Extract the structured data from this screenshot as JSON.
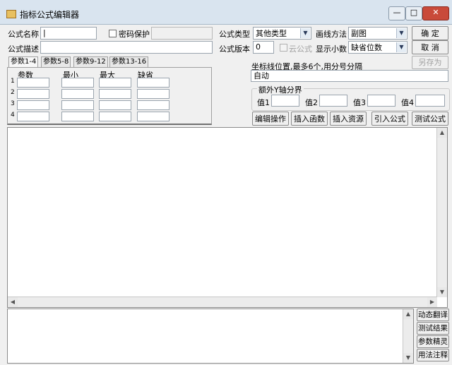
{
  "window": {
    "title": "指标公式编辑器",
    "min_label": "—",
    "max_label": "□",
    "close_label": "✕"
  },
  "form": {
    "name_label": "公式名称",
    "name_value": "|",
    "password_label": "密码保护",
    "desc_label": "公式描述",
    "desc_value": "",
    "type_label": "公式类型",
    "type_value": "其他类型",
    "version_label": "公式版本",
    "version_value": "0",
    "cloud_label": "云公式",
    "draw_label": "画线方法",
    "draw_value": "副图",
    "decimal_label": "显示小数",
    "decimal_value": "缺省位数",
    "ok_label": "确 定",
    "cancel_label": "取 消",
    "saveas_label": "另存为"
  },
  "params": {
    "tabs": [
      "参数1-4",
      "参数5-8",
      "参数9-12",
      "参数13-16"
    ],
    "headers": [
      "参数",
      "最小",
      "最大",
      "缺省"
    ],
    "rows": [
      "1",
      "2",
      "3",
      "4"
    ]
  },
  "axis": {
    "label": "坐标线位置,最多6个,用分号分隔",
    "value": "自动",
    "group_label": "额外Y轴分界",
    "v1": "值1",
    "v2": "值2",
    "v3": "值3",
    "v4": "值4"
  },
  "actions": {
    "edit": "编辑操作",
    "insert_func": "插入函数",
    "insert_res": "插入资源",
    "import": "引入公式",
    "test": "测试公式"
  },
  "side": {
    "dyn_translate": "动态翻译",
    "test_result": "测试结果",
    "param_sprite": "参数精灵",
    "usage": "用法注释"
  }
}
